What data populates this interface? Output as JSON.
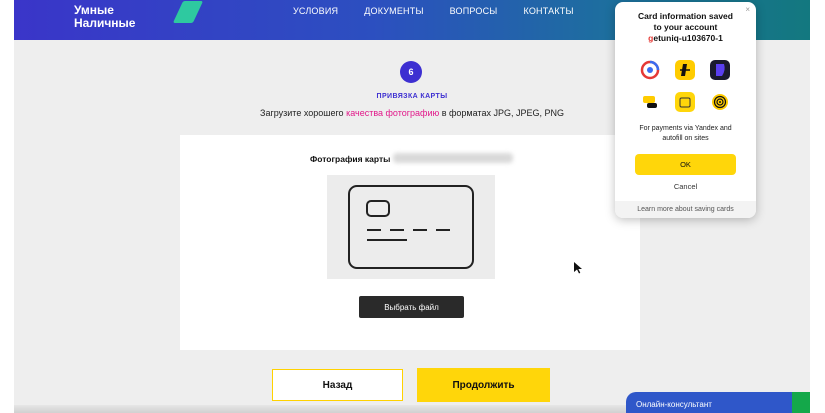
{
  "header": {
    "logo_line1": "Умные",
    "logo_line2": "Наличные",
    "nav": [
      "УСЛОВИЯ",
      "ДОКУМЕНТЫ",
      "ВОПРОСЫ",
      "КОНТАКТЫ"
    ]
  },
  "step": {
    "number": "6",
    "title": "ПРИВЯЗКА КАРТЫ",
    "subtitle_pre": "Загрузите хорошего ",
    "subtitle_highlight": "качества фотографию",
    "subtitle_post": " в форматах JPG, JPEG, PNG"
  },
  "upload": {
    "photo_label": "Фотография карты",
    "choose_button": "Выбрать файл"
  },
  "actions": {
    "back": "Назад",
    "continue": "Продолжить"
  },
  "chat": {
    "label": "Онлайн-консультант"
  },
  "popup": {
    "close": "×",
    "title_line1": "Card information saved",
    "title_line2": "to your account",
    "account_first": "g",
    "account_rest": "etuniq-u103670-1",
    "description_line1": "For payments via Yandex and",
    "description_line2": "autofill on sites",
    "ok": "OK",
    "cancel": "Cancel",
    "learn_more": "Learn more about saving cards",
    "service_icons": [
      "yandex-pay-icon",
      "yandex-eda-icon",
      "yandex-plus-icon",
      "yandex-go-icon",
      "yandex-market-icon",
      "yandex-music-icon"
    ]
  },
  "colors": {
    "accent_purple": "#3d2fd1",
    "highlight_pink": "#e2198a",
    "button_yellow": "#ffd60a",
    "chat_blue": "#2f57c9"
  }
}
